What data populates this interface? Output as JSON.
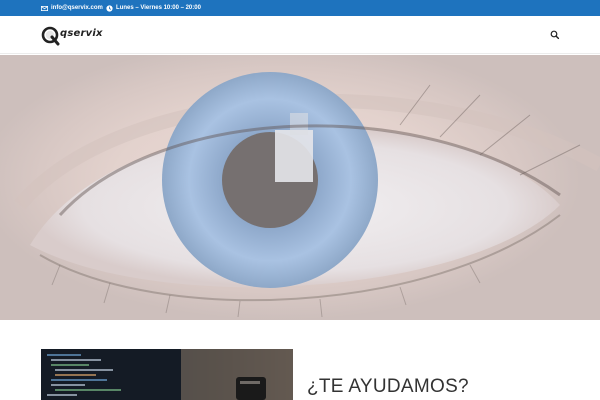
{
  "topbar": {
    "email": "info@qservix.com",
    "hours": "Lunes – Viernes 10:00 – 20:00"
  },
  "header": {
    "logo_text": "qservix"
  },
  "section": {
    "title": "¿TE AYUDAMOS?"
  },
  "colors": {
    "topbar_bg": "#1e73be",
    "text_dark": "#333333"
  },
  "icons": {
    "email": "envelope-icon",
    "hours": "clock-icon",
    "search": "search-icon"
  }
}
